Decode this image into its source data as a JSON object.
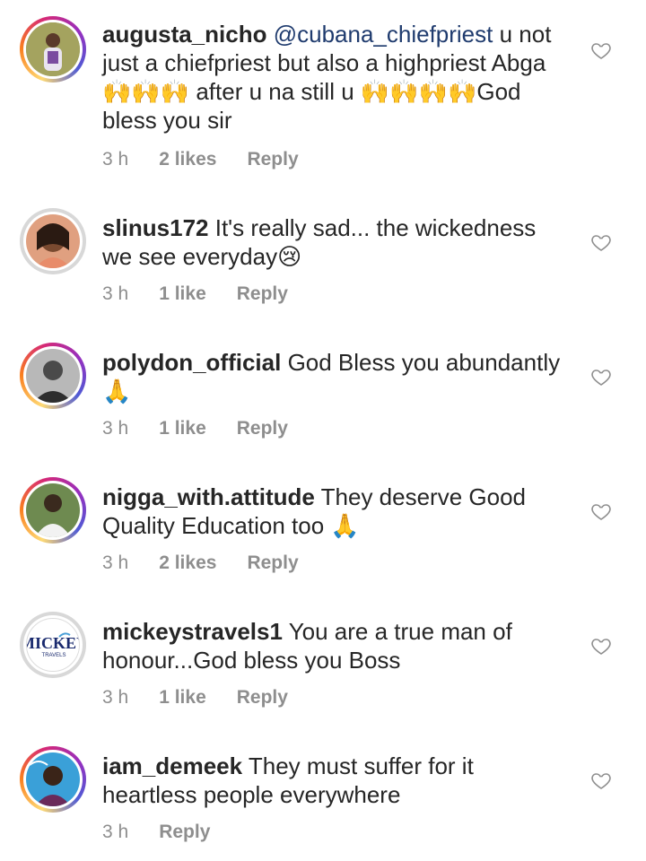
{
  "comments": [
    {
      "username": "augusta_nicho",
      "mention": "@cubana_chiefpriest",
      "text": " u not just a chiefpriest but also a highpriest Abga 🙌🙌🙌 after u na still u 🙌🙌🙌🙌God bless you sir",
      "time": "3 h",
      "likes": "2 likes",
      "reply": "Reply",
      "avatar_icon": "person-photo"
    },
    {
      "username": "slinus172",
      "text": " It's really sad... the wickedness we see everyday😢",
      "time": "3 h",
      "likes": "1 like",
      "reply": "Reply",
      "avatar_icon": "person-photo"
    },
    {
      "username": "polydon_official",
      "text": " God Bless you abundantly 🙏",
      "time": "3 h",
      "likes": "1 like",
      "reply": "Reply",
      "avatar_icon": "person-photo"
    },
    {
      "username": "nigga_with.attitude",
      "text": " They deserve Good Quality Education too 🙏",
      "time": "3 h",
      "likes": "2 likes",
      "reply": "Reply",
      "avatar_icon": "person-photo"
    },
    {
      "username": "mickeystravels1",
      "text": " You are a true man of honour...God bless you Boss",
      "time": "3 h",
      "likes": "1 like",
      "reply": "Reply",
      "avatar_icon": "mickey-travels-logo",
      "logo_text": "MICKEY",
      "logo_sub": "TRAVELS"
    },
    {
      "username": "iam_demeek",
      "text": " They must suffer for it heartless people everywhere",
      "time": "3 h",
      "reply": "Reply",
      "avatar_icon": "person-photo"
    }
  ],
  "colors": {
    "text": "#262626",
    "meta": "#8e8e8e",
    "mention": "#1f3b6e",
    "heart": "#8e8e8e"
  }
}
